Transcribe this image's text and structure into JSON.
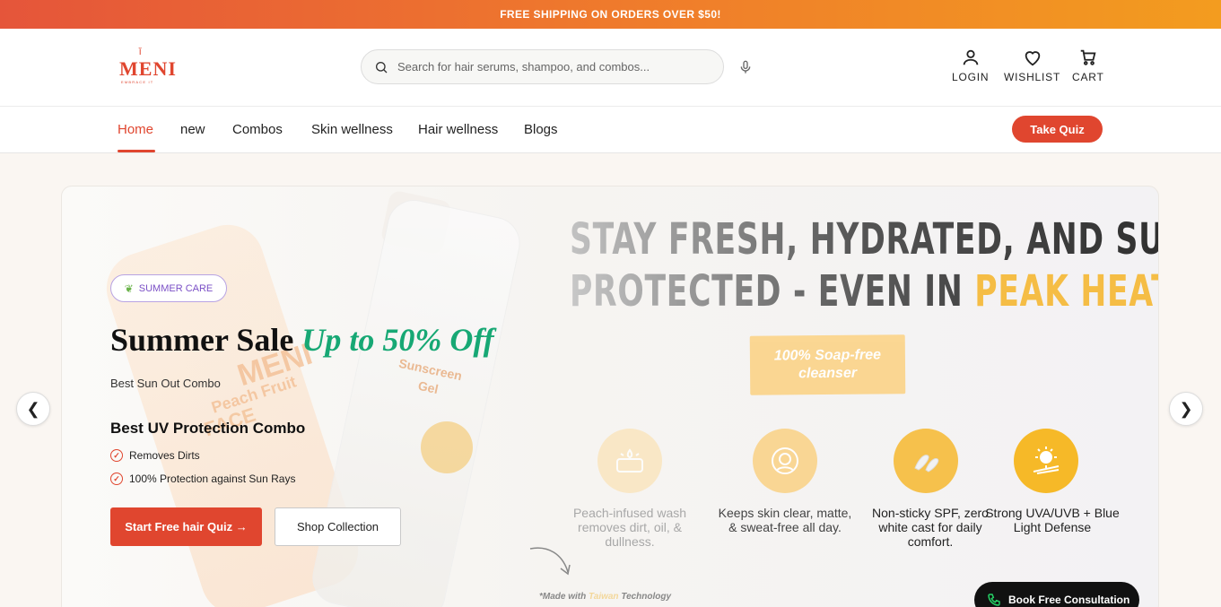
{
  "promo": {
    "text": "FREE SHIPPING ON ORDERS OVER $50!"
  },
  "header": {
    "logo": {
      "text": "MENI",
      "tagline": "EMBRACE IT"
    },
    "search": {
      "placeholder": "Search for hair serums, shampoo, and combos..."
    },
    "icons": {
      "login": "LOGIN",
      "wishlist": "WISHLIST",
      "cart": "CART"
    }
  },
  "nav": {
    "items": [
      "Home",
      "new",
      "Combos",
      "Skin wellness",
      "Hair wellness",
      "Blogs"
    ],
    "active": "Home",
    "quiz_label": "Take Quiz"
  },
  "hero": {
    "badge": "SUMMER CARE",
    "title_main": "Summer Sale ",
    "title_accent": "Up to 50% Off",
    "subtitle": "Best Sun Out Combo",
    "combo_title": "Best UV Protection Combo",
    "features": [
      "Removes Dirts",
      "100% Protection against Sun Rays"
    ],
    "primary_btn": "Start Free hair Quiz →",
    "secondary_btn": "Shop Collection",
    "product_text": {
      "bottle1": "MENI",
      "bottle1_sub": "Peach Fruit",
      "bottle1_sub2": "FACE",
      "bottle2": "Sunscreen",
      "bottle2_sub": "Gel"
    }
  },
  "banner": {
    "headline_line1": "STAY FRESH, HYDRATED, AND SUN-",
    "headline_line2a": "PROTECTED - EVEN IN ",
    "headline_line2b": "PEAK HEAT.",
    "soap_line1": "100% Soap-free",
    "soap_line2": "cleanser",
    "benefits": [
      {
        "text": "Peach-infused wash removes dirt, oil, & dullness.",
        "icon": "soap-bar-icon"
      },
      {
        "text": "Keeps skin clear, matte, & sweat-free all day.",
        "icon": "face-glow-icon"
      },
      {
        "text": "Non-sticky SPF, zero white cast for daily comfort.",
        "icon": "cream-swatch-icon"
      },
      {
        "text": "Strong UVA/UVB + Blue Light Defense",
        "icon": "sun-shield-icon"
      }
    ],
    "made_with_1": "*Made with ",
    "made_with_2": "Taiwan",
    "made_with_3": " Technology"
  },
  "carousel": {
    "prev": "❮",
    "next": "❯"
  },
  "consult": {
    "label": "Book Free Consultation"
  },
  "colors": {
    "brand": "#e0462f",
    "accent_green": "#17a874",
    "accent_yellow": "#f5bd45",
    "badge_purple": "#7a4fc6"
  }
}
